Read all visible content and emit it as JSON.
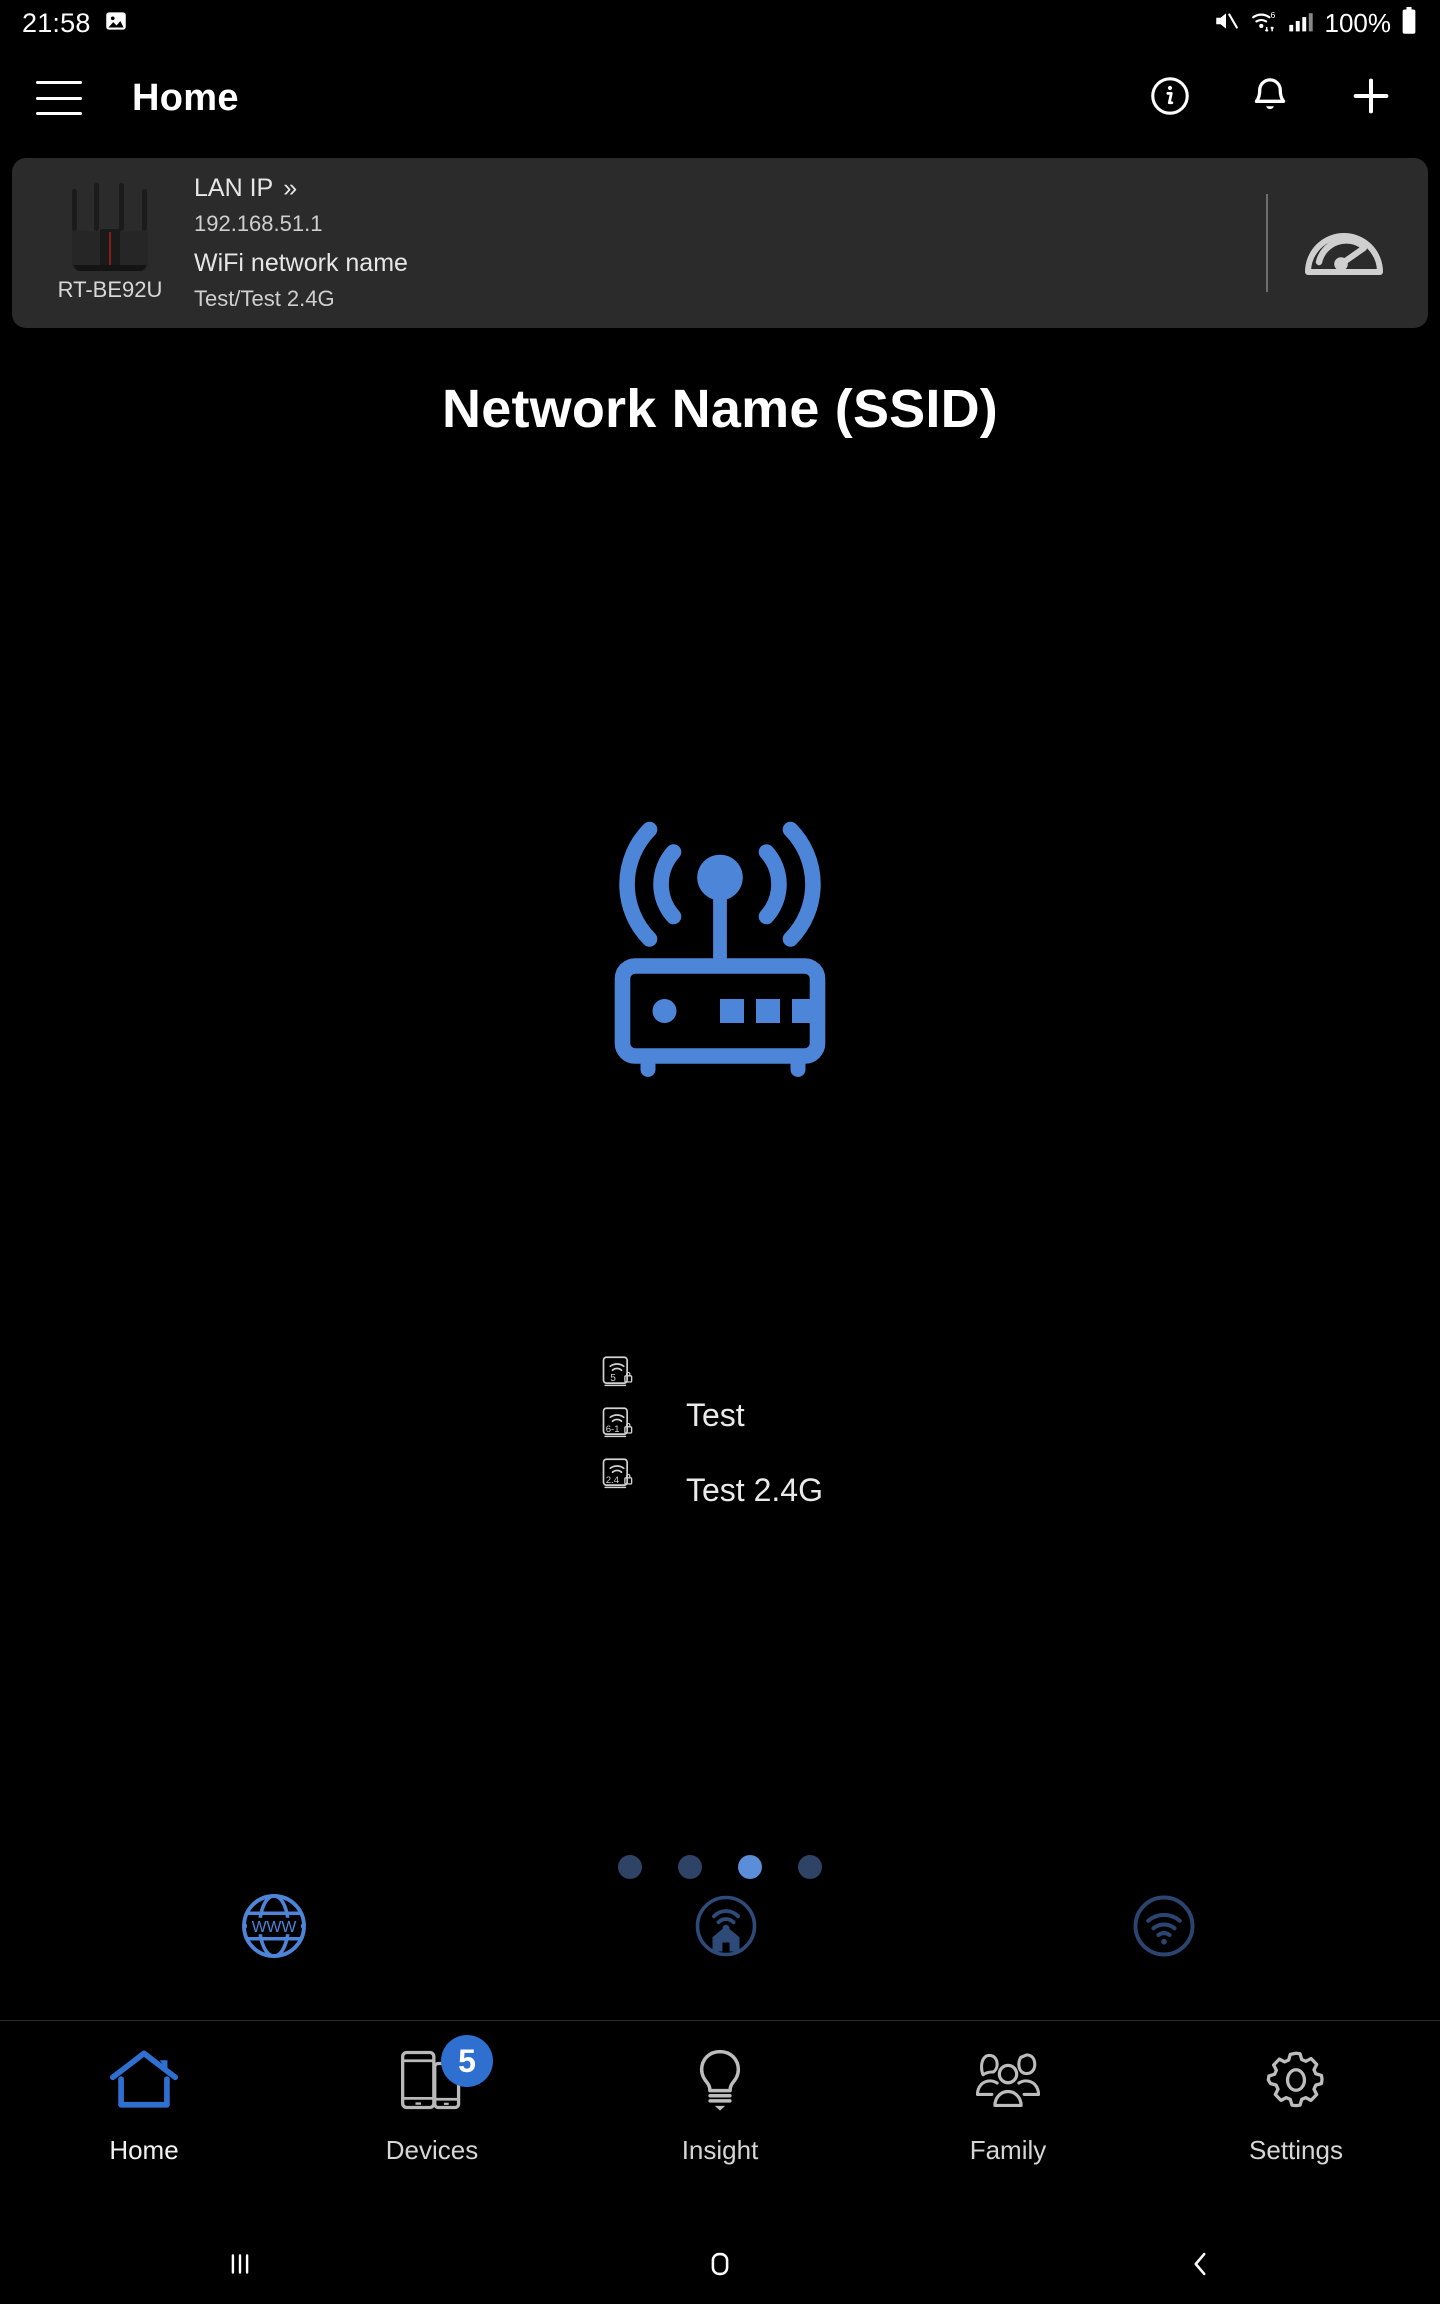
{
  "statusbar": {
    "clock": "21:58",
    "icons_left": [
      "image-icon"
    ],
    "icons_right": [
      "mute-icon",
      "wifi-6-icon",
      "cellular-signal-icon"
    ],
    "battery_percent": "100%"
  },
  "appbar": {
    "menu_icon": "hamburger-menu-icon",
    "title": "Home",
    "actions": [
      "info-icon",
      "notification-bell-icon",
      "add-icon"
    ]
  },
  "info_card": {
    "router_model": "RT-BE92U",
    "lan_ip_label": "LAN IP",
    "chevron": "»",
    "lan_ip_value": "192.168.51.1",
    "wifi_name_label": "WiFi network name",
    "wifi_name_value": "Test/Test 2.4G",
    "speed_icon": "speedometer-icon"
  },
  "main": {
    "headline": "Network Name (SSID)",
    "hero_icon": "router-wireless-icon",
    "bands": [
      {
        "badge": "5",
        "icon": "wifi-band-5-icon",
        "name": "Test"
      },
      {
        "badge": "6-1",
        "icon": "wifi-band-6-1-icon",
        "name": ""
      },
      {
        "badge": "2.4",
        "icon": "wifi-band-2-4-icon",
        "name": "Test 2.4G"
      }
    ],
    "band_names": [
      "Test",
      "Test 2.4G"
    ]
  },
  "pager": {
    "total": 4,
    "active_index": 2,
    "active_color": "#5b8dd9",
    "inactive_color": "#2e4366"
  },
  "connection_status": {
    "items": [
      {
        "name": "internet-globe-icon",
        "label": "WWW",
        "color": "#4d85d8"
      },
      {
        "name": "home-network-icon",
        "label": "",
        "color": "#2d4a78"
      },
      {
        "name": "wifi-status-icon",
        "label": "",
        "color": "#2c4570"
      }
    ]
  },
  "tabbar": {
    "active_color": "#2f6fd0",
    "tabs": [
      {
        "label": "Home",
        "icon": "home-icon",
        "active": true,
        "badge": ""
      },
      {
        "label": "Devices",
        "icon": "devices-icon",
        "active": false,
        "badge": "5"
      },
      {
        "label": "Insight",
        "icon": "lightbulb-icon",
        "active": false,
        "badge": ""
      },
      {
        "label": "Family",
        "icon": "family-icon",
        "active": false,
        "badge": ""
      },
      {
        "label": "Settings",
        "icon": "gear-icon",
        "active": false,
        "badge": ""
      }
    ]
  },
  "navbar": {
    "recents": "recents-icon",
    "home": "home-nav-icon",
    "back": "back-icon"
  }
}
